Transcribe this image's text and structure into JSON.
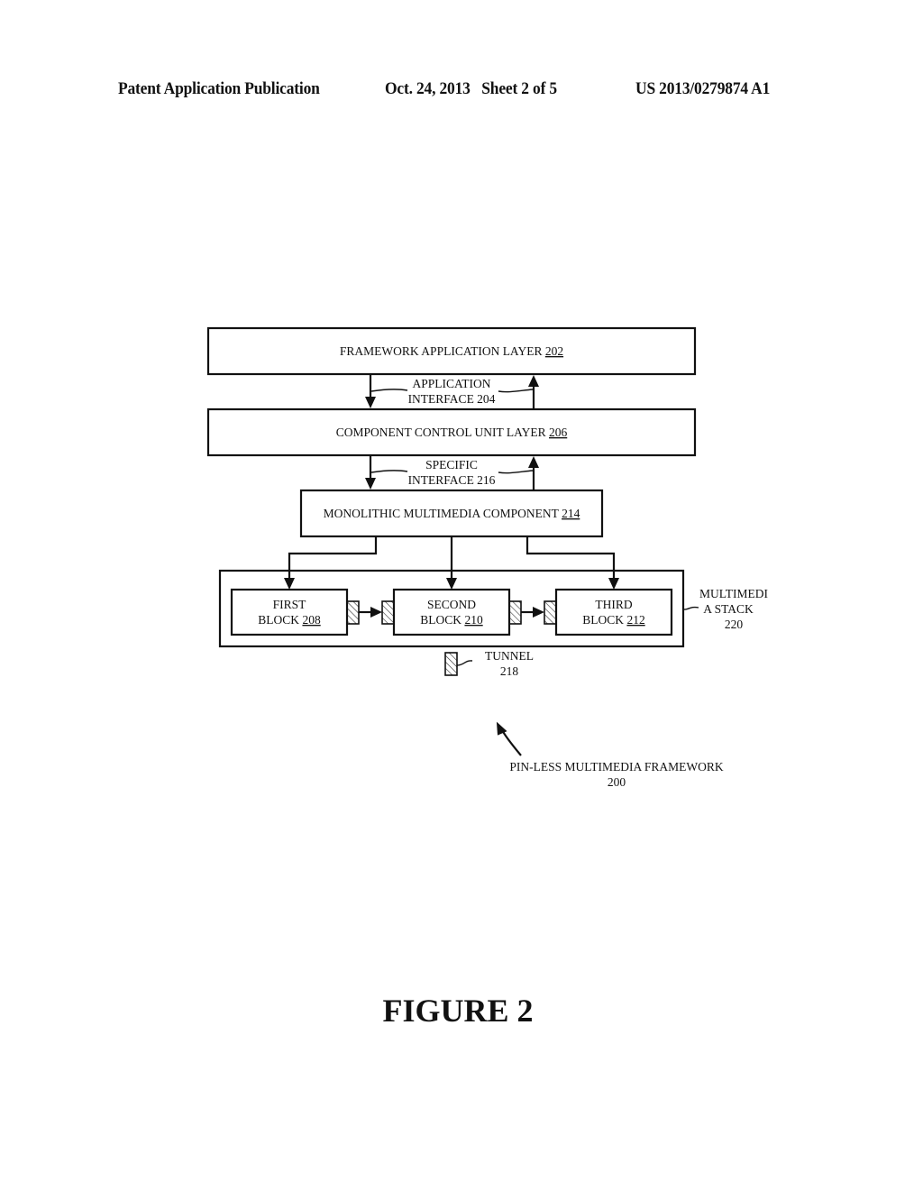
{
  "header": {
    "publication": "Patent Application Publication",
    "date_sheet": "Oct. 24, 2013   Sheet 2 of 5",
    "number": "US 2013/0279874 A1"
  },
  "diagram": {
    "framework_layer": {
      "label": "FRAMEWORK APPLICATION LAYER ",
      "ref": "202"
    },
    "app_interface": {
      "line1": "APPLICATION",
      "line2": "INTERFACE 204"
    },
    "control_layer": {
      "label": "COMPONENT CONTROL UNIT LAYER ",
      "ref": "206"
    },
    "specific_interface": {
      "line1": "SPECIFIC",
      "line2": "INTERFACE 216"
    },
    "monolithic": {
      "label": "MONOLITHIC MULTIMEDIA COMPONENT ",
      "ref": "214"
    },
    "first_block": {
      "line1": "FIRST",
      "line2": "BLOCK ",
      "ref": "208"
    },
    "second_block": {
      "line1": "SECOND",
      "line2": "BLOCK ",
      "ref": "210"
    },
    "third_block": {
      "line1": "THIRD",
      "line2": "BLOCK ",
      "ref": "212"
    },
    "stack": {
      "line1": "MULTIMEDI",
      "line2": "A STACK",
      "line3": "220"
    },
    "tunnel": {
      "line1": "TUNNEL",
      "line2": "218"
    },
    "framework": {
      "line1": "PIN-LESS MULTIMEDIA FRAMEWORK",
      "line2": "200"
    }
  },
  "figure_label": "FIGURE 2"
}
